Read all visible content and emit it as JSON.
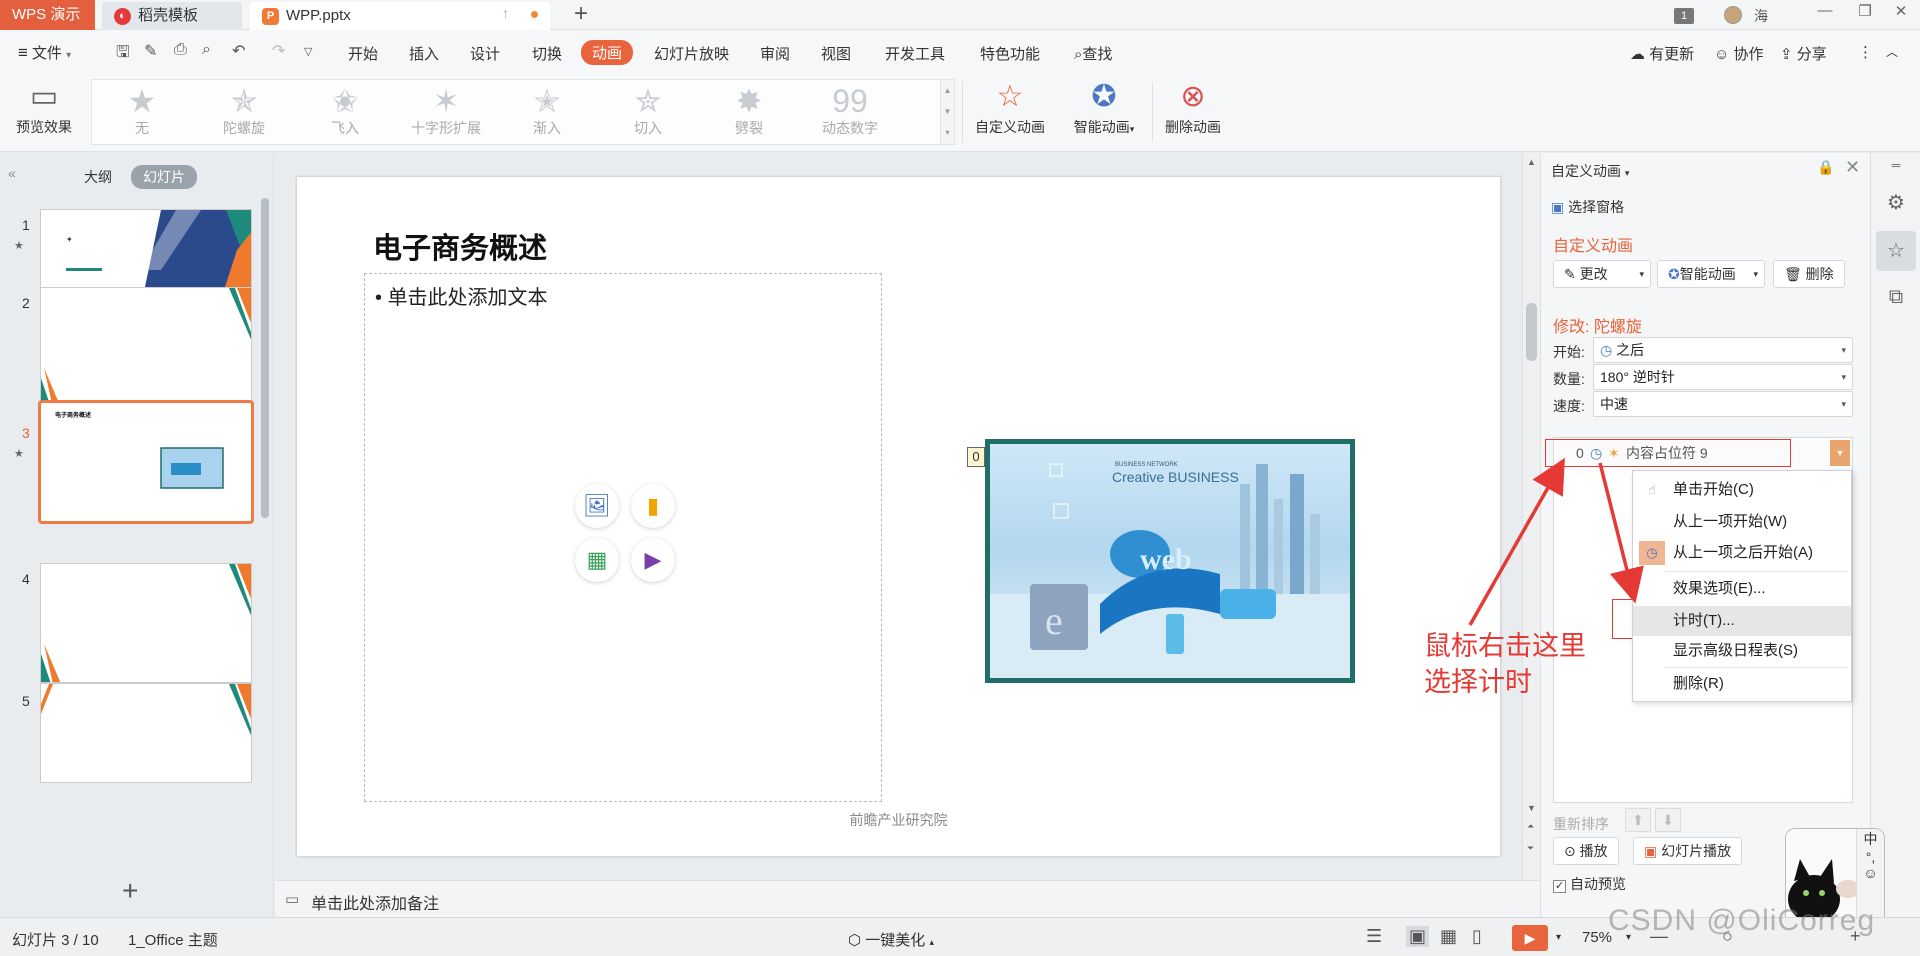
{
  "titlebar": {
    "app_name": "WPS 演示",
    "tabs": [
      {
        "label": "稻壳模板"
      },
      {
        "label": "WPP.pptx"
      }
    ],
    "window_number": "1",
    "user_name": "海"
  },
  "menubar": {
    "file_label": "文件",
    "items": [
      "开始",
      "插入",
      "设计",
      "切换",
      "动画",
      "幻灯片放映",
      "审阅",
      "视图",
      "开发工具",
      "特色功能"
    ],
    "active": "动画",
    "search_label": "查找",
    "right_items": [
      "有更新",
      "协作",
      "分享"
    ]
  },
  "ribbon": {
    "preview_label": "预览效果",
    "animations": [
      "无",
      "陀螺旋",
      "飞入",
      "十字形扩展",
      "渐入",
      "切入",
      "劈裂",
      "动态数字"
    ],
    "custom_anim_label": "自定义动画",
    "smart_anim_label": "智能动画",
    "delete_anim_label": "删除动画"
  },
  "left_panel": {
    "tab_outline": "大纲",
    "tab_slides": "幻灯片",
    "slide_numbers": [
      "1",
      "2",
      "3",
      "4",
      "5"
    ],
    "current_slide": "3"
  },
  "slide": {
    "title": "电子商务概述",
    "placeholder_text": "单击此处添加文本",
    "footer": "前瞻产业研究院",
    "image_tag": "0",
    "image_caption": "Creative BUSINESS",
    "image_word": "web"
  },
  "notes": {
    "placeholder": "单击此处添加备注"
  },
  "task_pane": {
    "title": "自定义动画",
    "select_pane": "选择窗格",
    "section_title": "自定义动画",
    "change_btn": "更改",
    "smart_btn": "智能动画",
    "delete_btn": "删除",
    "modify_title": "修改: 陀螺旋",
    "start_label": "开始:",
    "start_value": "之后",
    "amount_label": "数量:",
    "amount_value": "180° 逆时针",
    "speed_label": "速度:",
    "speed_value": "中速",
    "list_item": {
      "num": "0",
      "name": "内容占位符 9"
    },
    "reorder_label": "重新排序",
    "play_btn": "播放",
    "slideshow_btn": "幻灯片播放",
    "auto_preview": "自动预览",
    "auto_preview_checked": true
  },
  "context_menu": {
    "items": [
      {
        "label": "单击开始(C)"
      },
      {
        "label": "从上一项开始(W)"
      },
      {
        "label": "从上一项之后开始(A)"
      },
      {
        "label": "效果选项(E)..."
      },
      {
        "label": "计时(T)..."
      },
      {
        "label": "显示高级日程表(S)"
      },
      {
        "label": "删除(R)"
      }
    ],
    "highlighted": "计时(T)..."
  },
  "annotation": {
    "line1": "鼠标右击这里",
    "line2": "选择计时",
    "color": "#e53935"
  },
  "statusbar": {
    "slide_info": "幻灯片 3 / 10",
    "theme": "1_Office 主题",
    "beautify": "一键美化",
    "zoom": "75%"
  },
  "watermark": "CSDN @OliCorreg",
  "colors": {
    "accent": "#e8643c",
    "app_tab": "#e35f3e",
    "selected_slide_border": "#ef7a43"
  }
}
